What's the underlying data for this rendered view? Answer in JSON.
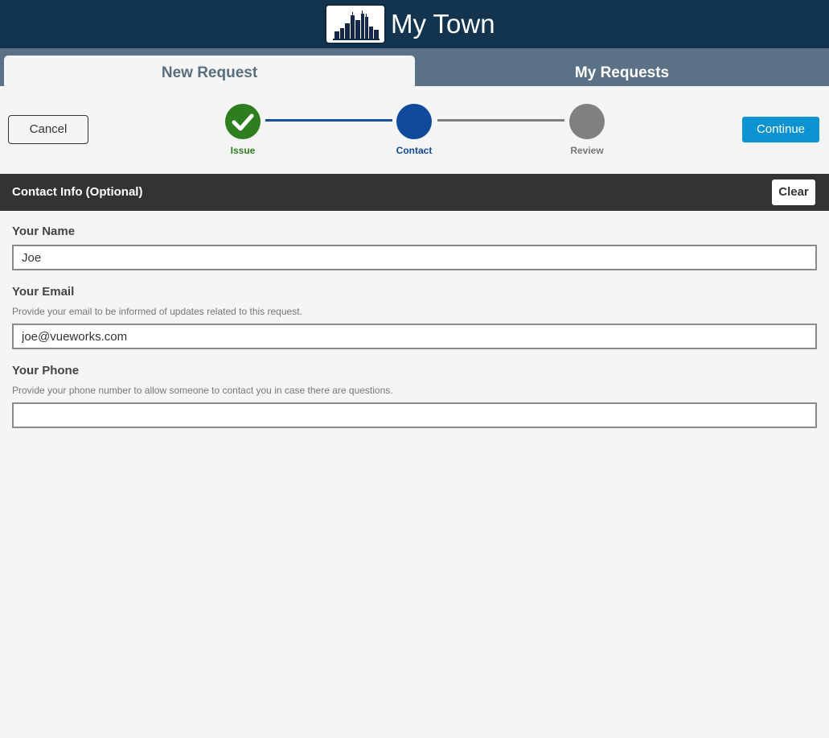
{
  "header": {
    "title": "My Town",
    "logo_icon": "city-skyline-icon"
  },
  "tabs": [
    {
      "label": "New Request",
      "active": true
    },
    {
      "label": "My Requests",
      "active": false
    }
  ],
  "wizard": {
    "cancel_label": "Cancel",
    "continue_label": "Continue",
    "steps": [
      {
        "label": "Issue",
        "state": "complete",
        "color": "#2e7d1f"
      },
      {
        "label": "Contact",
        "state": "current",
        "color": "#0f4a9c"
      },
      {
        "label": "Review",
        "state": "pending",
        "color": "#808080"
      }
    ]
  },
  "contact": {
    "title": "Contact Info (Optional)",
    "clear_label": "Clear",
    "fields": [
      {
        "label": "Your Name",
        "help": "",
        "value": "Joe"
      },
      {
        "label": "Your Email",
        "help": "Provide your email to be informed of updates related to this request.",
        "value": "joe@vueworks.com"
      },
      {
        "label": "Your Phone",
        "help": "Provide your phone number to allow someone to contact you in case there are questions.",
        "value": ""
      }
    ]
  },
  "colors": {
    "header_bg": "#12344f",
    "tab_bar_bg": "#5b7185",
    "section_bar_bg": "#333333",
    "primary_button": "#0a93d0"
  }
}
